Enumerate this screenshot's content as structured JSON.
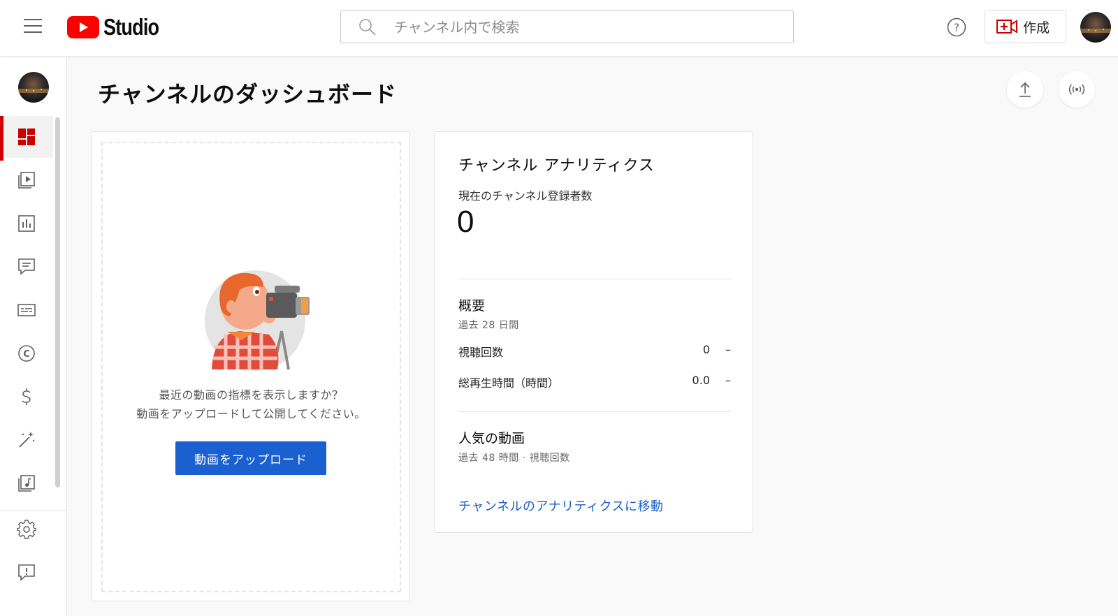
{
  "header": {
    "logo_text": "Studio",
    "search_placeholder": "チャンネル内で検索",
    "create_label": "作成"
  },
  "page": {
    "title": "チャンネルのダッシュボード"
  },
  "upload_card": {
    "line1": "最近の動画の指標を表示しますか？",
    "line2": "動画をアップロードして公開してください。",
    "button_label": "動画をアップロード"
  },
  "analytics_card": {
    "title": "チャンネル アナリティクス",
    "subscribers_label": "現在のチャンネル登録者数",
    "subscribers_value": "0",
    "summary_title": "概要",
    "summary_period": "過去 28 日間",
    "metrics": [
      {
        "label": "視聴回数",
        "value": "0",
        "trend": "–"
      },
      {
        "label": "総再生時間（時間）",
        "value": "0.0",
        "trend": "–"
      }
    ],
    "popular_title": "人気の動画",
    "popular_period": "過去 48 時間 · 視聴回数",
    "link_label": "チャンネルのアナリティクスに移動"
  },
  "colors": {
    "brand_red": "#ff0000",
    "active_red": "#cc0000",
    "primary_blue": "#1a60d0",
    "link_blue": "#1a5fc8"
  },
  "sidebar_icons": [
    "dashboard-icon",
    "content-icon",
    "analytics-icon",
    "comments-icon",
    "subtitles-icon",
    "copyright-icon",
    "monetization-icon",
    "customization-icon",
    "audio-library-icon",
    "settings-icon",
    "feedback-icon"
  ]
}
